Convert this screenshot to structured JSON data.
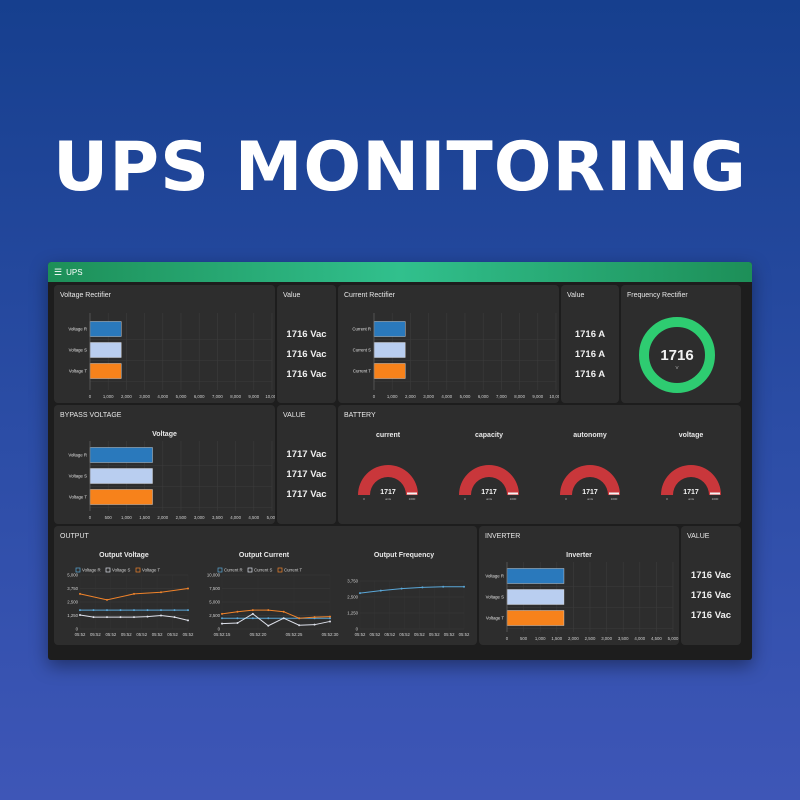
{
  "headline": "UPS MONITORING",
  "app": {
    "title": "UPS",
    "menu_icon": "hamburger-icon"
  },
  "colors": {
    "bar_r": "#2a79bc",
    "bar_s": "#b9cef0",
    "bar_t": "#f7821b",
    "gauge": "#c9373b",
    "ring": "#2ecc71",
    "line_blue": "#5aa7d8",
    "line_white": "#dde0ea",
    "line_orange": "#f0832a"
  },
  "voltage_rectifier": {
    "title": "Voltage Rectifier",
    "labels": [
      "Voltage R",
      "Voltage S",
      "Voltage T"
    ],
    "values": [
      1716,
      1716,
      1716
    ],
    "ticks": [
      "0",
      "1,000",
      "2,000",
      "3,000",
      "4,000",
      "5,000",
      "6,000",
      "7,000",
      "8,000",
      "9,000",
      "10,000"
    ],
    "xmax": 10000
  },
  "voltage_value": {
    "title": "Value",
    "values": [
      "1716 Vac",
      "1716 Vac",
      "1716 Vac"
    ]
  },
  "current_rectifier": {
    "title": "Current Rectifier",
    "labels": [
      "Current R",
      "Current S",
      "Current T"
    ],
    "values": [
      1716,
      1716,
      1716
    ],
    "ticks": [
      "0",
      "1,000",
      "2,000",
      "3,000",
      "4,000",
      "5,000",
      "6,000",
      "7,000",
      "8,000",
      "9,000",
      "10,000"
    ],
    "xmax": 10000
  },
  "current_value": {
    "title": "Value",
    "values": [
      "1716 A",
      "1716 A",
      "1716 A"
    ]
  },
  "frequency_rectifier": {
    "title": "Frequency Rectifier",
    "value": "1716",
    "unit": "V"
  },
  "bypass": {
    "title": "BYPASS VOLTAGE",
    "chart_title": "Voltage",
    "labels": [
      "Voltage R",
      "Voltage S",
      "Voltage T"
    ],
    "values": [
      1717,
      1717,
      1717
    ],
    "ticks": [
      "0",
      "500",
      "1,000",
      "1,500",
      "2,000",
      "2,500",
      "3,000",
      "3,500",
      "4,000",
      "4,500",
      "5,000"
    ],
    "xmax": 5000
  },
  "bypass_value": {
    "title": "VALUE",
    "values": [
      "1717 Vac",
      "1717 Vac",
      "1717 Vac"
    ]
  },
  "battery": {
    "title": "BATTERY",
    "gauges": [
      {
        "label": "current",
        "value": "1717",
        "min": "0",
        "max": "1000",
        "unit": "units"
      },
      {
        "label": "capacity",
        "value": "1717",
        "min": "0",
        "max": "1000",
        "unit": "units"
      },
      {
        "label": "autonomy",
        "value": "1717",
        "min": "0",
        "max": "1000",
        "unit": "units"
      },
      {
        "label": "voltage",
        "value": "1717",
        "min": "0",
        "max": "1000",
        "unit": "units"
      }
    ]
  },
  "output": {
    "title": "OUTPUT"
  },
  "output_voltage": {
    "title": "Output Voltage",
    "legend": [
      "Voltage R",
      "Voltage S",
      "Voltage T"
    ],
    "yticks": [
      "5,000",
      "3,750",
      "2,500",
      "1,250",
      "0"
    ],
    "ymax": 5000,
    "xticks": [
      "05:52",
      "05:52",
      "05:52",
      "05:52",
      "05:52",
      "05:52",
      "05:52",
      "05:52"
    ],
    "series": [
      {
        "name": "Voltage R",
        "values": [
          1750,
          1750,
          1750,
          1750,
          1750,
          1750,
          1750,
          1750,
          1750
        ]
      },
      {
        "name": "Voltage S",
        "values": [
          1300,
          1100,
          1100,
          1100,
          1100,
          1150,
          1250,
          1100,
          800
        ]
      },
      {
        "name": "Voltage T",
        "values": [
          3250,
          null,
          2700,
          null,
          3250,
          null,
          3400,
          null,
          3750
        ]
      }
    ]
  },
  "output_current": {
    "title": "Output Current",
    "legend": [
      "Current R",
      "Current S",
      "Current T"
    ],
    "yticks": [
      "10,000",
      "7,500",
      "5,000",
      "2,500",
      "0"
    ],
    "ymax": 10000,
    "xticks": [
      "05:52:15",
      "05:52:20",
      "05:52:25",
      "05:52:30"
    ],
    "series": [
      {
        "name": "Current R",
        "values": [
          2000,
          2000,
          2000,
          2000,
          2000,
          2000,
          2000,
          2000
        ]
      },
      {
        "name": "Current S",
        "values": [
          1000,
          1100,
          2800,
          600,
          2000,
          700,
          800,
          1400
        ]
      },
      {
        "name": "Current T",
        "values": [
          2800,
          3200,
          3500,
          3500,
          3200,
          2000,
          2200,
          2300
        ]
      }
    ]
  },
  "output_frequency": {
    "title": "Output Frequency",
    "yticks": [
      "3,750",
      "2,500",
      "1,250",
      "0"
    ],
    "ymax": 3750,
    "xticks": [
      "05:52",
      "05:52",
      "05:52",
      "05:52",
      "05:52",
      "05:52",
      "05:52",
      "05:52"
    ],
    "values": [
      2800,
      3000,
      3150,
      3250,
      3300,
      3300
    ]
  },
  "inverter": {
    "title": "INVERTER",
    "chart_title": "Inverter",
    "labels": [
      "Voltage R",
      "Voltage S",
      "Voltage T"
    ],
    "values": [
      1716,
      1716,
      1716
    ],
    "ticks": [
      "0",
      "500",
      "1,000",
      "1,500",
      "2,000",
      "2,500",
      "3,000",
      "3,500",
      "4,000",
      "4,500",
      "5,000"
    ],
    "xmax": 5000
  },
  "inverter_value": {
    "title": "VALUE",
    "values": [
      "1716 Vac",
      "1716 Vac",
      "1716 Vac"
    ]
  }
}
